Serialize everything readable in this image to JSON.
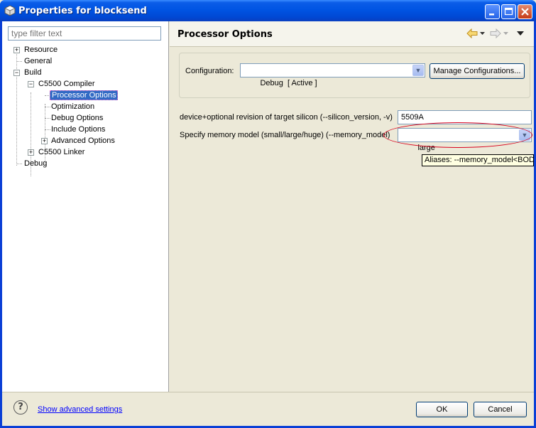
{
  "window": {
    "title": "Properties for blocksend"
  },
  "filter": {
    "placeholder": "type filter text"
  },
  "tree": {
    "items": [
      {
        "label": "Resource"
      },
      {
        "label": "General"
      },
      {
        "label": "Build"
      },
      {
        "label": "C5500 Compiler"
      },
      {
        "label": "Processor Options"
      },
      {
        "label": "Optimization"
      },
      {
        "label": "Debug Options"
      },
      {
        "label": "Include Options"
      },
      {
        "label": "Advanced Options"
      },
      {
        "label": "C5500 Linker"
      },
      {
        "label": "Debug"
      }
    ],
    "expanders": {
      "plus": "+",
      "minus": "−"
    }
  },
  "page": {
    "title": "Processor Options"
  },
  "config": {
    "label": "Configuration:",
    "value": "Debug  [ Active ]",
    "manage_button": "Manage Configurations..."
  },
  "options": {
    "silicon_label": "device+optional revision of target silicon (--silicon_version, -v)",
    "silicon_value": "5509A",
    "memory_label": "Specify memory model (small/large/huge) (--memory_model)",
    "memory_value": "large",
    "tooltip": "Aliases: --memory_model<BODY>"
  },
  "footer": {
    "help_glyph": "?",
    "advanced_link": "Show advanced settings",
    "ok_label": "OK",
    "cancel_label": "Cancel"
  },
  "colors": {
    "selection": "#316ac5",
    "highlight_ellipse": "#d8001c",
    "titlebar": "#0054e3"
  }
}
